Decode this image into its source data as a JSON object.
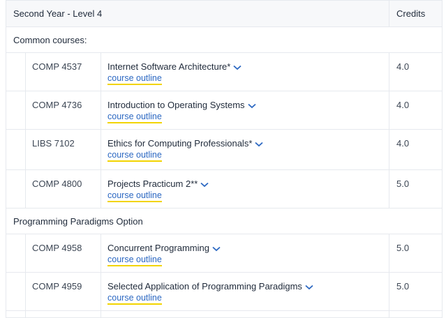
{
  "table": {
    "header": {
      "term": "Second Year - Level 4",
      "credits": "Credits"
    },
    "common_label": "Common courses:",
    "common_courses": [
      {
        "code": "COMP 4537",
        "title": "Internet Software Architecture*",
        "outline": "course outline",
        "credits": "4.0"
      },
      {
        "code": "COMP 4736",
        "title": "Introduction to Operating Systems",
        "outline": "course outline",
        "credits": "4.0"
      },
      {
        "code": "LIBS 7102",
        "title": "Ethics for Computing Professionals*",
        "outline": "course outline",
        "credits": "4.0"
      },
      {
        "code": "COMP 4800",
        "title": "Projects Practicum 2**",
        "outline": "course outline",
        "credits": "5.0"
      }
    ],
    "option_label": "Programming Paradigms Option",
    "option_courses": [
      {
        "code": "COMP 4958",
        "title": "Concurrent Programming",
        "outline": "course outline",
        "credits": "5.0"
      },
      {
        "code": "COMP 4959",
        "title": "Selected Application of Programming Paradigms",
        "outline": "course outline",
        "credits": "5.0"
      }
    ]
  },
  "icons": {
    "expand": "chevron-down-icon"
  },
  "colors": {
    "link": "#2c68c2",
    "underline": "#f2d400",
    "header_bg": "#f7f8fa",
    "border": "#e6e9ee"
  }
}
